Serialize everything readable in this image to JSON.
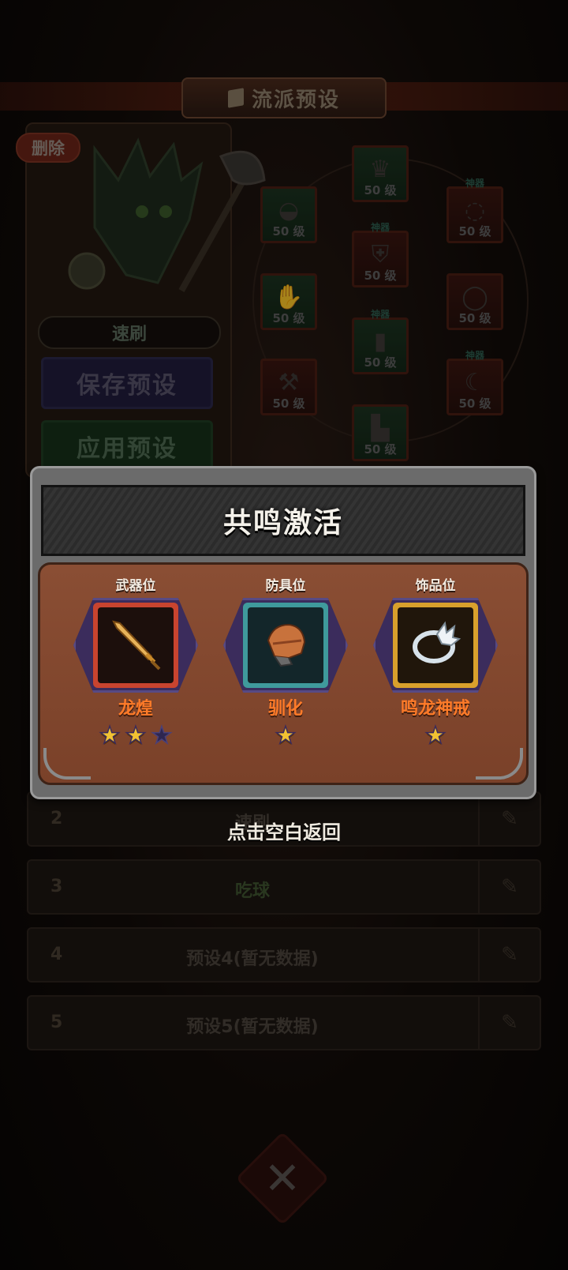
{
  "background": {
    "title": "流派预设",
    "delete_label": "删除",
    "current_preset_name": "速刷",
    "save_label": "保存预设",
    "apply_label": "应用预设",
    "equipment_slots": [
      {
        "level": "50 级",
        "tag": "",
        "icon": "helmet-icon",
        "style": "green"
      },
      {
        "level": "50 级",
        "tag": "",
        "icon": "crown-icon",
        "style": "green"
      },
      {
        "level": "50 级",
        "tag": "神器",
        "icon": "necklace-icon",
        "style": "red"
      },
      {
        "level": "50 级",
        "tag": "",
        "icon": "gauntlet-icon",
        "style": "green"
      },
      {
        "level": "50 级",
        "tag": "神器",
        "icon": "armor-icon",
        "style": "red"
      },
      {
        "level": "50 级",
        "tag": "",
        "icon": "ring-icon",
        "style": "red"
      },
      {
        "level": "50 级",
        "tag": "神器",
        "icon": "legs-icon",
        "style": "green"
      },
      {
        "level": "50 级",
        "tag": "",
        "icon": "axe-icon",
        "style": "red"
      },
      {
        "level": "50 级",
        "tag": "神器",
        "icon": "horn-icon",
        "style": "red"
      },
      {
        "level": "50 级",
        "tag": "",
        "icon": "boots-icon",
        "style": "green"
      }
    ],
    "preset_rows": [
      {
        "num": "2",
        "name": "速刷"
      },
      {
        "num": "3",
        "name": "吃球"
      },
      {
        "num": "4",
        "name": "预设4(暂无数据)"
      },
      {
        "num": "5",
        "name": "预设5(暂无数据)"
      }
    ]
  },
  "modal": {
    "title": "共鸣激活",
    "slots": [
      {
        "position": "武器位",
        "item_name": "龙煌",
        "stars": 2,
        "max_stars": 3,
        "icon": "sword-icon"
      },
      {
        "position": "防具位",
        "item_name": "驯化",
        "stars": 1,
        "max_stars": 1,
        "icon": "armor-icon"
      },
      {
        "position": "饰品位",
        "item_name": "鸣龙神戒",
        "stars": 1,
        "max_stars": 1,
        "icon": "dragon-ring-icon"
      }
    ]
  },
  "hint": "点击空白返回",
  "colors": {
    "item_name": "#ff7b29",
    "weapon_frame": "#c8442f",
    "armor_frame": "#3f9a9c",
    "jewel_frame": "#d8a02c",
    "star": "#f1c232"
  }
}
